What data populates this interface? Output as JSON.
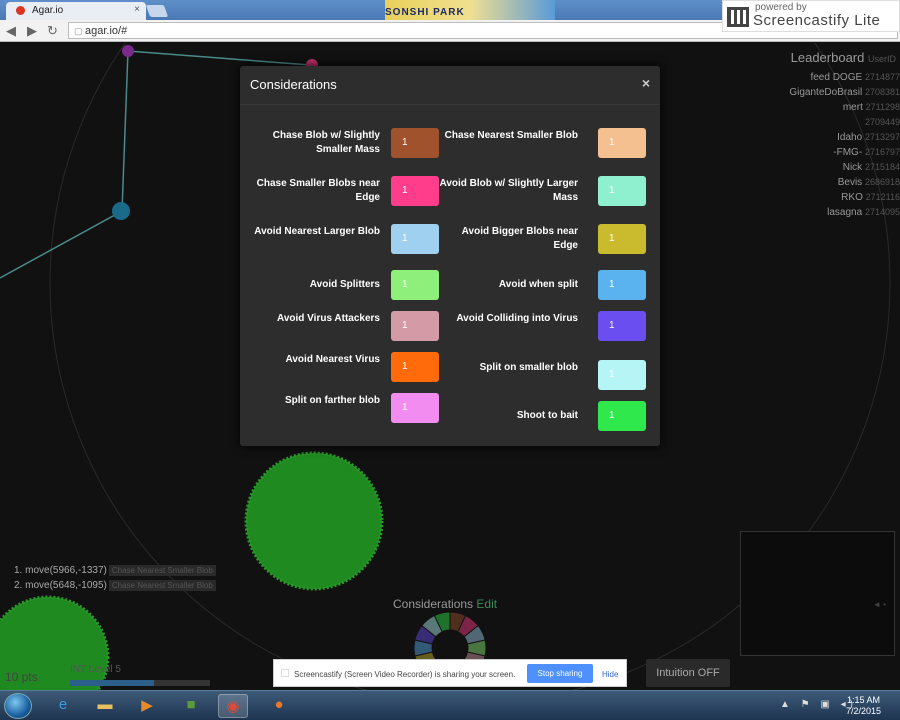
{
  "browser": {
    "tab_title": "Agar.io",
    "tab_close": "×",
    "banner_text": "SONSHI PARK",
    "url": "agar.io/#",
    "back": "◀",
    "forward": "▶",
    "reload": "↻"
  },
  "screencastify": {
    "powered_by": "powered by",
    "name": "Screencastify Lite"
  },
  "leaderboard": {
    "title": "Leaderboard",
    "title_suffix": "UserID",
    "rows": [
      {
        "name": "feed DOGE",
        "score": "2714877"
      },
      {
        "name": "GiganteDoBrasil",
        "score": "2708381"
      },
      {
        "name": "mert",
        "score": "2711298"
      },
      {
        "name": "",
        "score": "2709449"
      },
      {
        "name": "Idaho",
        "score": "2713297"
      },
      {
        "name": "-FMG-",
        "score": "2716797"
      },
      {
        "name": "Nick",
        "score": "2715184"
      },
      {
        "name": "Bevis",
        "score": "2686918"
      },
      {
        "name": "RKO",
        "score": "2712116"
      },
      {
        "name": "lasagna",
        "score": "2714095"
      }
    ]
  },
  "modal": {
    "title": "Considerations",
    "close": "×",
    "left_items": [
      {
        "label": "Chase Blob w/ Slightly Smaller Mass",
        "value": "1",
        "color": "#a0522d"
      },
      {
        "label": "Chase Smaller Blobs near Edge",
        "value": "1",
        "color": "#ff3d8b"
      },
      {
        "label": "Avoid Nearest Larger Blob",
        "value": "1",
        "color": "#9fd0f0"
      },
      {
        "label": "Avoid Splitters",
        "value": "1",
        "color": "#8ef07a"
      },
      {
        "label": "Avoid Virus Attackers",
        "value": "1",
        "color": "#d49aa6"
      },
      {
        "label": "Avoid Nearest Virus",
        "value": "1",
        "color": "#ff6a0a"
      },
      {
        "label": "Split on farther blob",
        "value": "1",
        "color": "#f38cf0"
      }
    ],
    "right_items": [
      {
        "label": "Chase Nearest Smaller Blob",
        "value": "1",
        "color": "#f5c08f"
      },
      {
        "label": "Avoid Blob w/ Slightly Larger Mass",
        "value": "1",
        "color": "#8ff0cf"
      },
      {
        "label": "Avoid Bigger Blobs near Edge",
        "value": "1",
        "color": "#c9ba2e"
      },
      {
        "label": "Avoid when split",
        "value": "1",
        "color": "#5ab2ee"
      },
      {
        "label": "Avoid Colliding into Virus",
        "value": "1",
        "color": "#6a4ef0"
      },
      {
        "label": "Split on smaller blob",
        "value": "1",
        "color": "#b5f5f5"
      },
      {
        "label": "Shoot to bait",
        "value": "1",
        "color": "#2ee84c"
      }
    ]
  },
  "log": [
    {
      "index": "1.",
      "text": "move(5966,-1337)",
      "tag": "Chase Nearest Smaller Blob"
    },
    {
      "index": "2.",
      "text": "move(5648,-1095)",
      "tag": "Chase Nearest Smaller Blob"
    }
  ],
  "hud": {
    "considerations_label": "Considerations",
    "edit_label": "Edit",
    "points": "10 pts",
    "int_level": "INT Level 5",
    "xp_progress": 0.6,
    "intuition_button": "Intuition OFF",
    "minimap_arrow": "◄ •"
  },
  "share_bar": {
    "message": "Screencastify (Screen Video Recorder) is sharing your screen.",
    "stop_label": "Stop sharing",
    "hide_label": "Hide"
  },
  "taskbar": {
    "time": "1:15 AM",
    "date": "7/2/2015",
    "tray_icons": "▲ ⚑ ▣ ◂)"
  },
  "wheel_colors": [
    "#a0522d",
    "#ff3d8b",
    "#9fd0f0",
    "#8ef07a",
    "#d49aa6",
    "#ff6a0a",
    "#f38cf0",
    "#f5c08f",
    "#8ff0cf",
    "#c9ba2e",
    "#5ab2ee",
    "#6a4ef0",
    "#b5f5f5",
    "#2ee84c"
  ]
}
